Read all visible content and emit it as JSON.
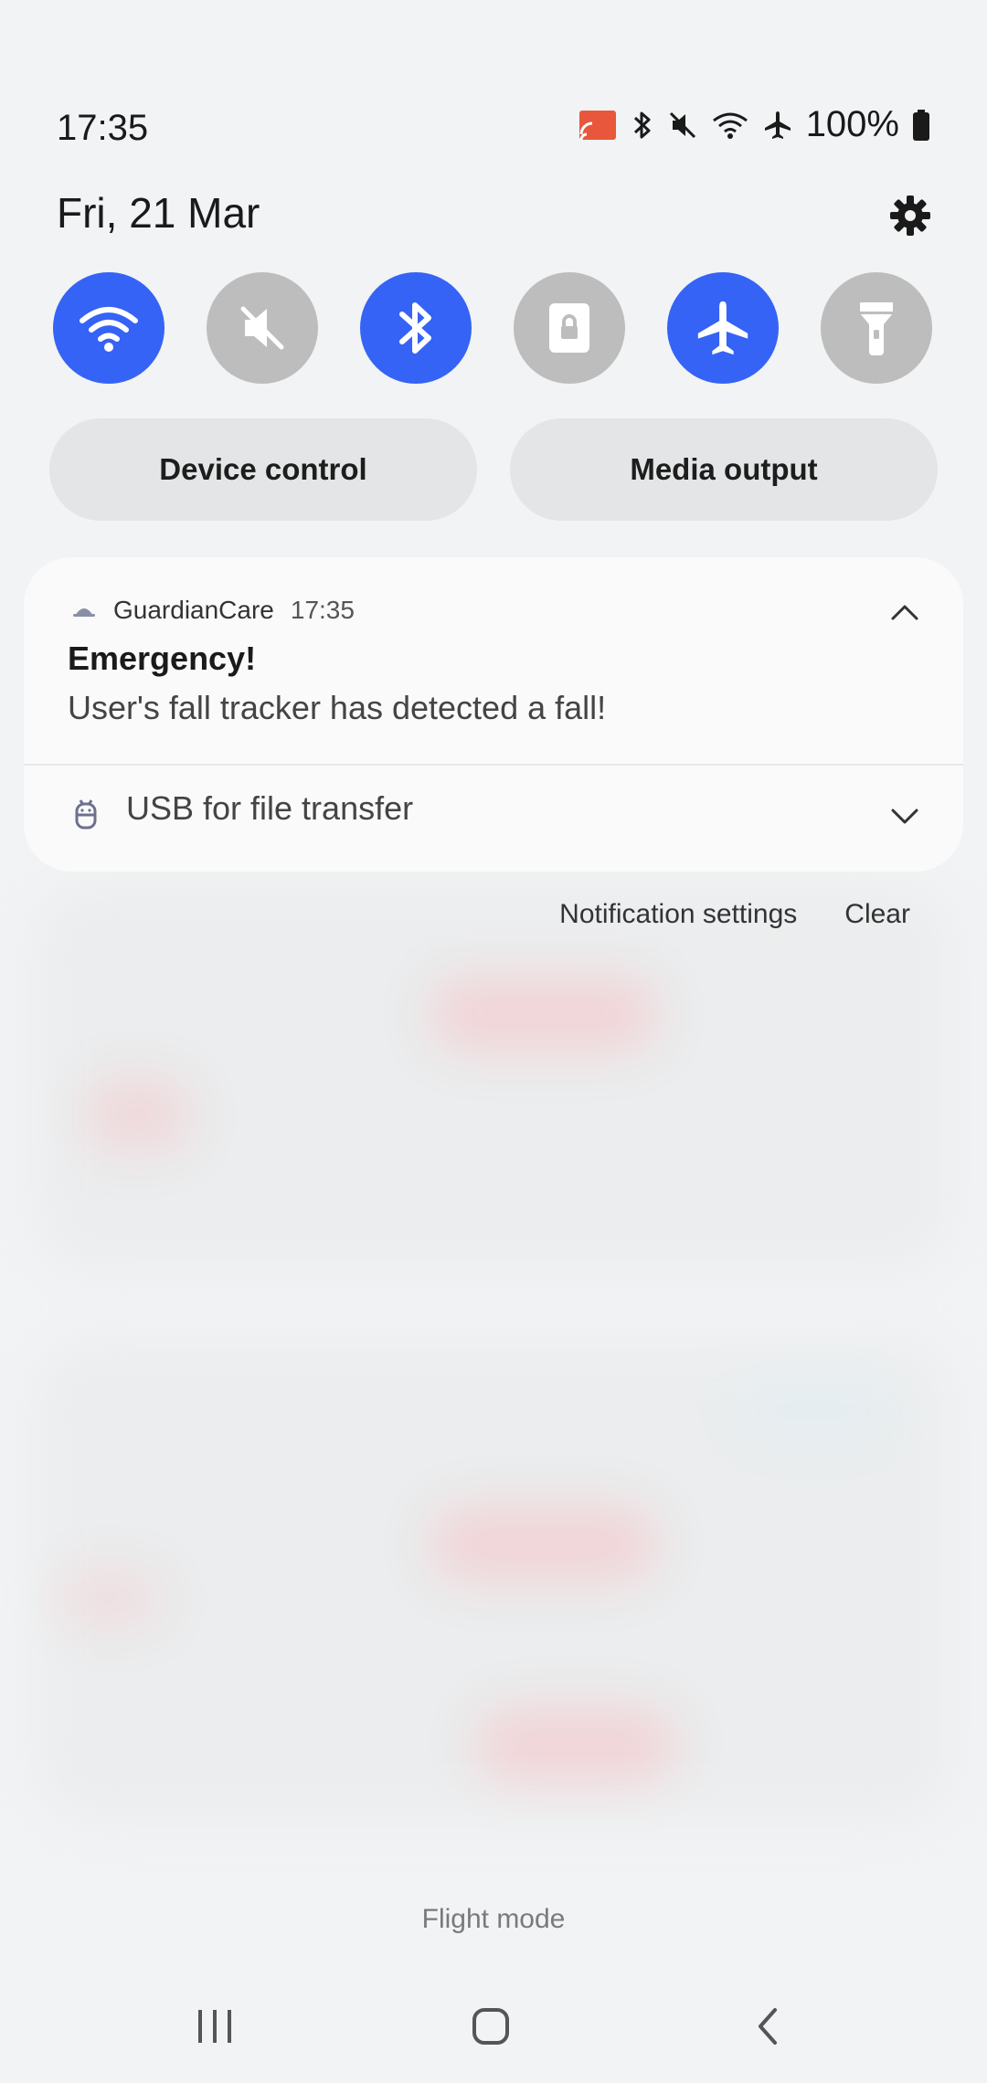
{
  "status_bar": {
    "time": "17:35",
    "battery": "100%",
    "icons": [
      "cast-icon",
      "bluetooth-icon",
      "mute-icon",
      "wifi-icon",
      "airplane-icon",
      "battery-icon"
    ]
  },
  "header": {
    "date": "Fri, 21 Mar"
  },
  "quick_settings": [
    {
      "name": "wifi",
      "icon": "wifi-icon",
      "active": true
    },
    {
      "name": "sound",
      "icon": "mute-icon",
      "active": false
    },
    {
      "name": "bluetooth",
      "icon": "bluetooth-icon",
      "active": true
    },
    {
      "name": "rotation-lock",
      "icon": "lock-icon",
      "active": false
    },
    {
      "name": "flight-mode",
      "icon": "airplane-icon",
      "active": true
    },
    {
      "name": "torch",
      "icon": "flashlight-icon",
      "active": false
    }
  ],
  "pills": {
    "device_control": "Device control",
    "media_output": "Media output"
  },
  "notification": {
    "app_name": "GuardianCare",
    "time": "17:35",
    "title": "Emergency!",
    "body": "User's fall tracker has detected a fall!"
  },
  "usb": {
    "label": "USB for file transfer"
  },
  "actions": {
    "settings": "Notification settings",
    "clear": "Clear"
  },
  "footer": {
    "label": "Flight mode"
  },
  "colors": {
    "active": "#3563f5",
    "inactive": "#bdbdbd",
    "background": "#f1f3f4"
  }
}
